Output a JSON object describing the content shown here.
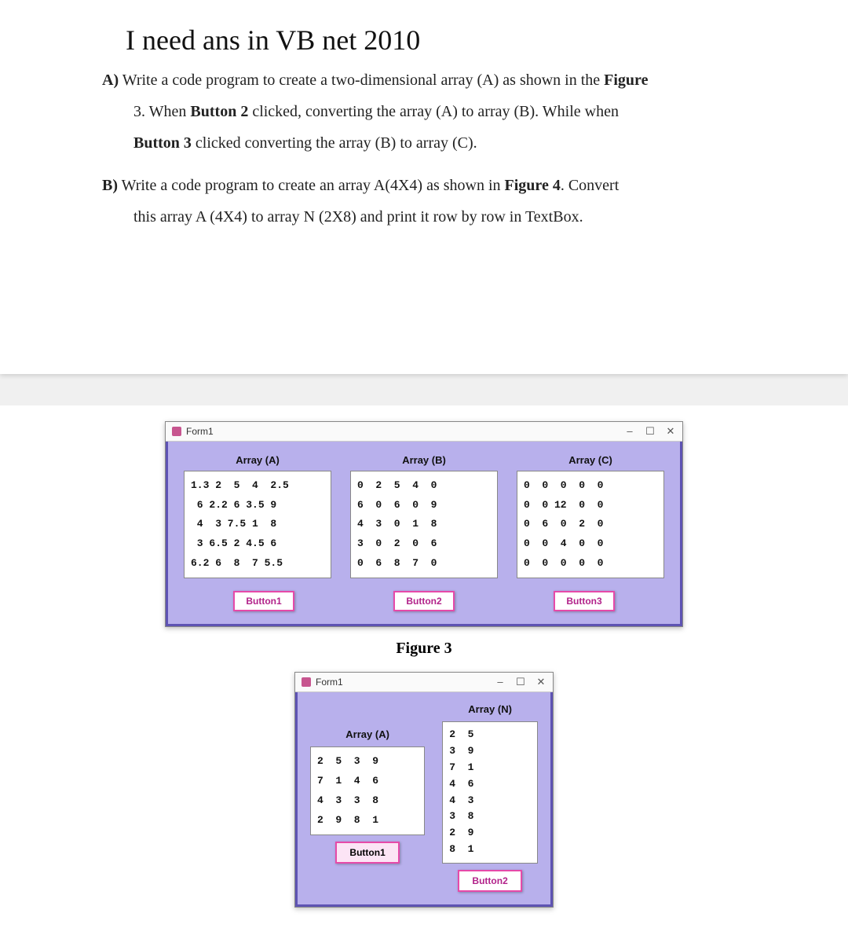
{
  "heading": "I need ans in VB net 2010",
  "question": {
    "partA": {
      "label": "A)",
      "line1_pre": " Write a code program to create a two-dimensional array (A) as shown in the ",
      "line1_bold": "Figure",
      "line2_pre": "3. When ",
      "line2_b1": "Button 2",
      "line2_mid": " clicked, converting the array (A) to array (B). While when",
      "line3_b1": "Button 3",
      "line3_post": " clicked converting the array (B) to array (C)."
    },
    "partB": {
      "label": "B)",
      "line1_pre": " Write a code program to create an array A(4X4) as shown in ",
      "line1_bold": "Figure 4",
      "line1_post": ". Convert",
      "line2": "this array A (4X4) to array N (2X8) and print it row by row in TextBox."
    }
  },
  "figure3": {
    "formTitle": "Form1",
    "arrays": {
      "A": {
        "title": "Array (A)",
        "rows": [
          "1.3 2  5  4  2.5",
          " 6 2.2 6 3.5 9",
          " 4  3 7.5 1  8",
          " 3 6.5 2 4.5 6",
          "6.2 6  8  7 5.5"
        ]
      },
      "B": {
        "title": "Array (B)",
        "rows": [
          "0  2  5  4  0",
          "6  0  6  0  9",
          "4  3  0  1  8",
          "3  0  2  0  6",
          "0  6  8  7  0"
        ]
      },
      "C": {
        "title": "Array (C)",
        "rows": [
          "0  0  0  0  0",
          "0  0 12  0  0",
          "0  6  0  2  0",
          "0  0  4  0  0",
          "0  0  0  0  0"
        ]
      }
    },
    "buttons": {
      "b1": "Button1",
      "b2": "Button2",
      "b3": "Button3"
    },
    "caption": "Figure 3"
  },
  "figure4": {
    "formTitle": "Form1",
    "arrayA": {
      "title": "Array (A)",
      "rows": [
        "2  5  3  9",
        "7  1  4  6",
        "4  3  3  8",
        "2  9  8  1"
      ]
    },
    "arrayN": {
      "title": "Array (N)",
      "rows": [
        "2  5",
        "3  9",
        "7  1",
        "4  6",
        "4  3",
        "3  8",
        "2  9",
        "8  1"
      ]
    },
    "buttons": {
      "b1": "Button1",
      "b2": "Button2"
    }
  },
  "winControls": {
    "min": "–",
    "max": "☐",
    "close": "✕"
  }
}
